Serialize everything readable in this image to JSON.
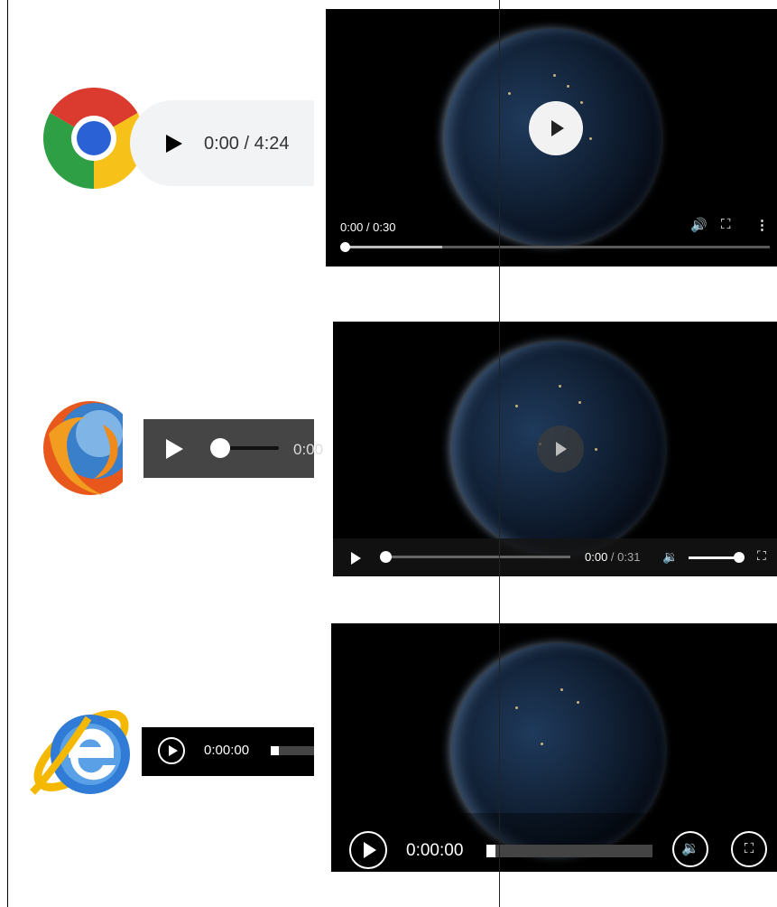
{
  "chrome": {
    "audio_time": "0:00 / 4:24",
    "video_time": "0:00 / 0:30",
    "video_buffered_fraction": 0.23
  },
  "firefox": {
    "audio_time": "0:00",
    "video_current": "0:00",
    "video_duration": " / 0:31"
  },
  "ie": {
    "audio_time": "0:00:00",
    "video_time": "0:00:00"
  }
}
